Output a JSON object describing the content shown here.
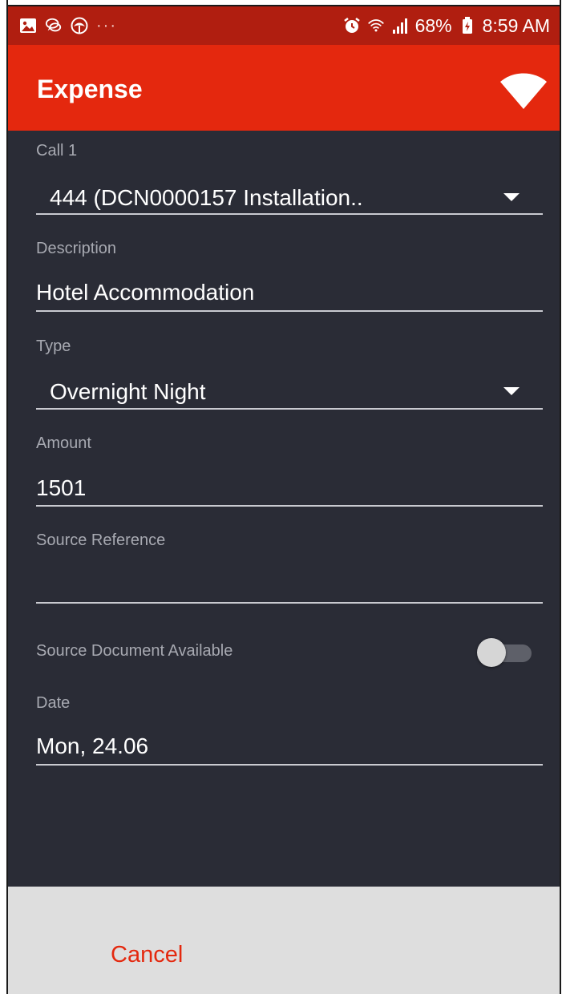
{
  "status_bar": {
    "time": "8:59 AM",
    "battery": "68%",
    "overflow": "···",
    "left_icons": [
      "image-icon",
      "chat-icon",
      "leaf-icon"
    ],
    "right_icons": [
      "alarm-icon",
      "wifi-icon",
      "signal-icon",
      "battery-icon"
    ]
  },
  "app_bar": {
    "title": "Expense",
    "action_icon": "wifi-status-icon",
    "background_color": "#e4280e"
  },
  "form": {
    "call": {
      "label": "Call 1",
      "value": "444 (DCN0000157 Installation.."
    },
    "description": {
      "label": "Description",
      "value": "Hotel Accommodation"
    },
    "type": {
      "label": "Type",
      "value": "Overnight Night"
    },
    "amount": {
      "label": "Amount",
      "value": "1501"
    },
    "source_reference": {
      "label": "Source Reference",
      "value": ""
    },
    "source_document": {
      "label": "Source Document Available",
      "enabled": false
    },
    "date": {
      "label": "Date",
      "value": "Mon, 24.06"
    }
  },
  "footer": {
    "cancel_label": "Cancel"
  },
  "colors": {
    "accent": "#e4280e",
    "status_bar": "#b01e10",
    "background": "#2a2c36",
    "footer": "#dedede"
  }
}
